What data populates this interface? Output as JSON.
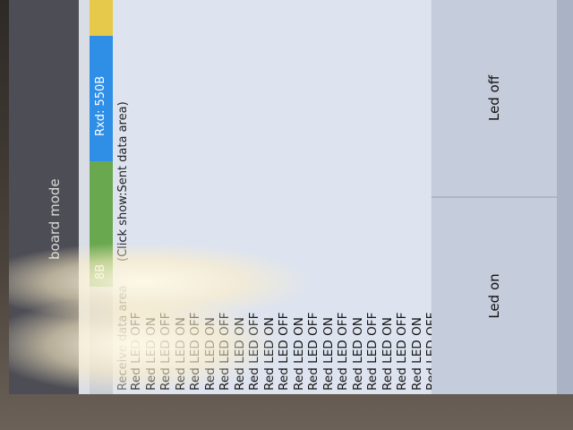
{
  "header": {
    "title": "board mode"
  },
  "status": {
    "tx_fragment": "8B",
    "rx": "Rxd: 550B"
  },
  "data_area": {
    "receive_label": "Receive data area",
    "hint": "(Click show:Sent data area)",
    "lines": [
      "Red LED OFF",
      "Red LED ON",
      "Red LED OFF",
      "Red LED ON",
      "Red LED OFF",
      "Red LED ON",
      "Red LED OFF",
      "Red LED ON",
      "Red LED OFF",
      "Red LED ON",
      "Red LED OFF",
      "Red LED ON",
      "Red LED OFF",
      "Red LED ON",
      "Red LED OFF",
      "Red LED ON",
      "Red LED OFF",
      "Red LED ON",
      "Red LED OFF",
      "Red LED ON",
      "Red LED OFF"
    ]
  },
  "buttons": {
    "led_on": "Led on",
    "led_off": "Led off"
  },
  "colors": {
    "tx_bar": "#6aa84f",
    "rx_bar": "#2f8fe6",
    "accent_yellow": "#e6c84a"
  }
}
